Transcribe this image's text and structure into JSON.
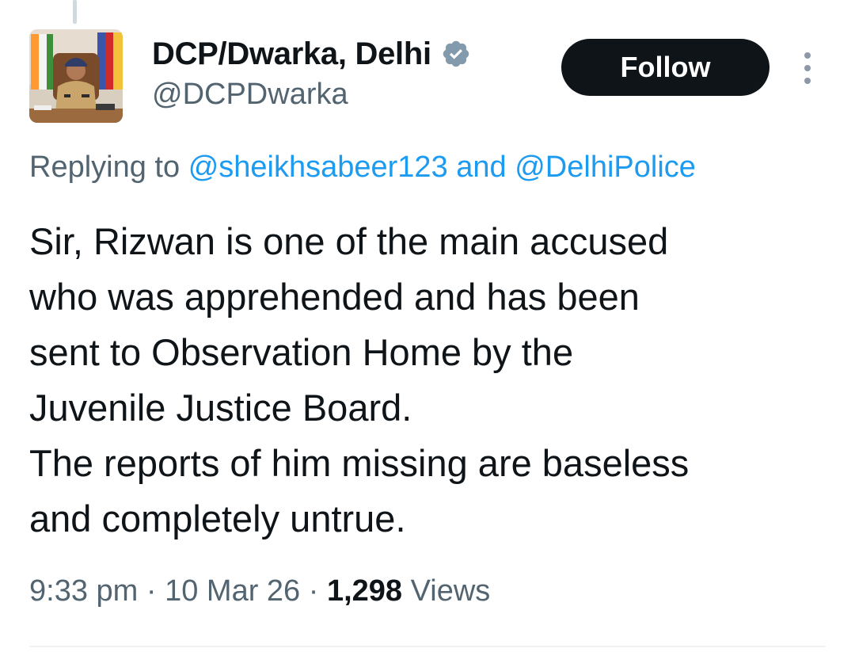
{
  "author": {
    "display_name": "DCP/Dwarka, Delhi",
    "handle": "@DCPDwarka",
    "verified": true,
    "verified_icon": "verified-badge-icon",
    "avatar_icon": "profile-photo"
  },
  "actions": {
    "follow_label": "Follow",
    "more_icon": "more-vertical-icon"
  },
  "reply_context": {
    "prefix": "Replying to",
    "mention_1": "@sheikhsabeer123",
    "conjunction": "and",
    "mention_2": "@DelhiPolice"
  },
  "tweet": {
    "lines": [
      "Sir, Rizwan is one of the main accused",
      "who was apprehended and has been",
      "sent to Observation Home by the",
      "Juvenile Justice Board.",
      "The reports of him missing are baseless",
      "and completely untrue."
    ]
  },
  "meta": {
    "time": "9:33 pm",
    "separator": "·",
    "date": "10 Mar 26",
    "views_count": "1,298",
    "views_label": "Views"
  },
  "colors": {
    "text": "#0f1419",
    "secondary": "#536471",
    "link": "#1d9bf0",
    "follow_bg": "#0f1419",
    "verified": "#829aab"
  }
}
